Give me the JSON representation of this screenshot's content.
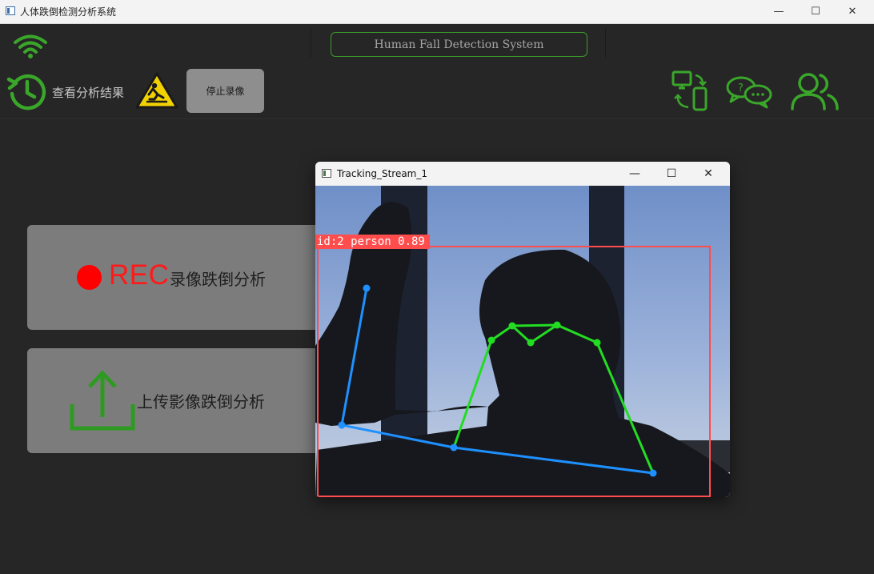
{
  "window": {
    "title": "人体跌倒检测分析系统",
    "minimize_glyph": "—",
    "maximize_glyph": "☐",
    "close_glyph": "✕"
  },
  "header": {
    "system_title": "Human Fall Detection System",
    "wifi_icon": "wifi-icon",
    "accent_color": "#3aa62a"
  },
  "toolbar": {
    "history_label": "查看分析结果",
    "history_icon": "history-clock-icon",
    "warning_icon": "fall-warning-icon",
    "stop_recording_label": "停止录像",
    "right_icons": [
      "device-sync-icon",
      "chat-bubbles-icon",
      "users-icon"
    ]
  },
  "cards": {
    "record": {
      "rec_text": "REC",
      "label": "录像跌倒分析",
      "dot_color": "#ff0000"
    },
    "upload": {
      "label": "上传影像跌倒分析",
      "icon": "upload-icon"
    }
  },
  "tracking_window": {
    "title": "Tracking_Stream_1",
    "detection_label": "id:2 person 0.89",
    "box_color": "#ff4d4d",
    "skeleton_arm_color": "#1e90ff",
    "skeleton_torso_color": "#22dd22"
  }
}
